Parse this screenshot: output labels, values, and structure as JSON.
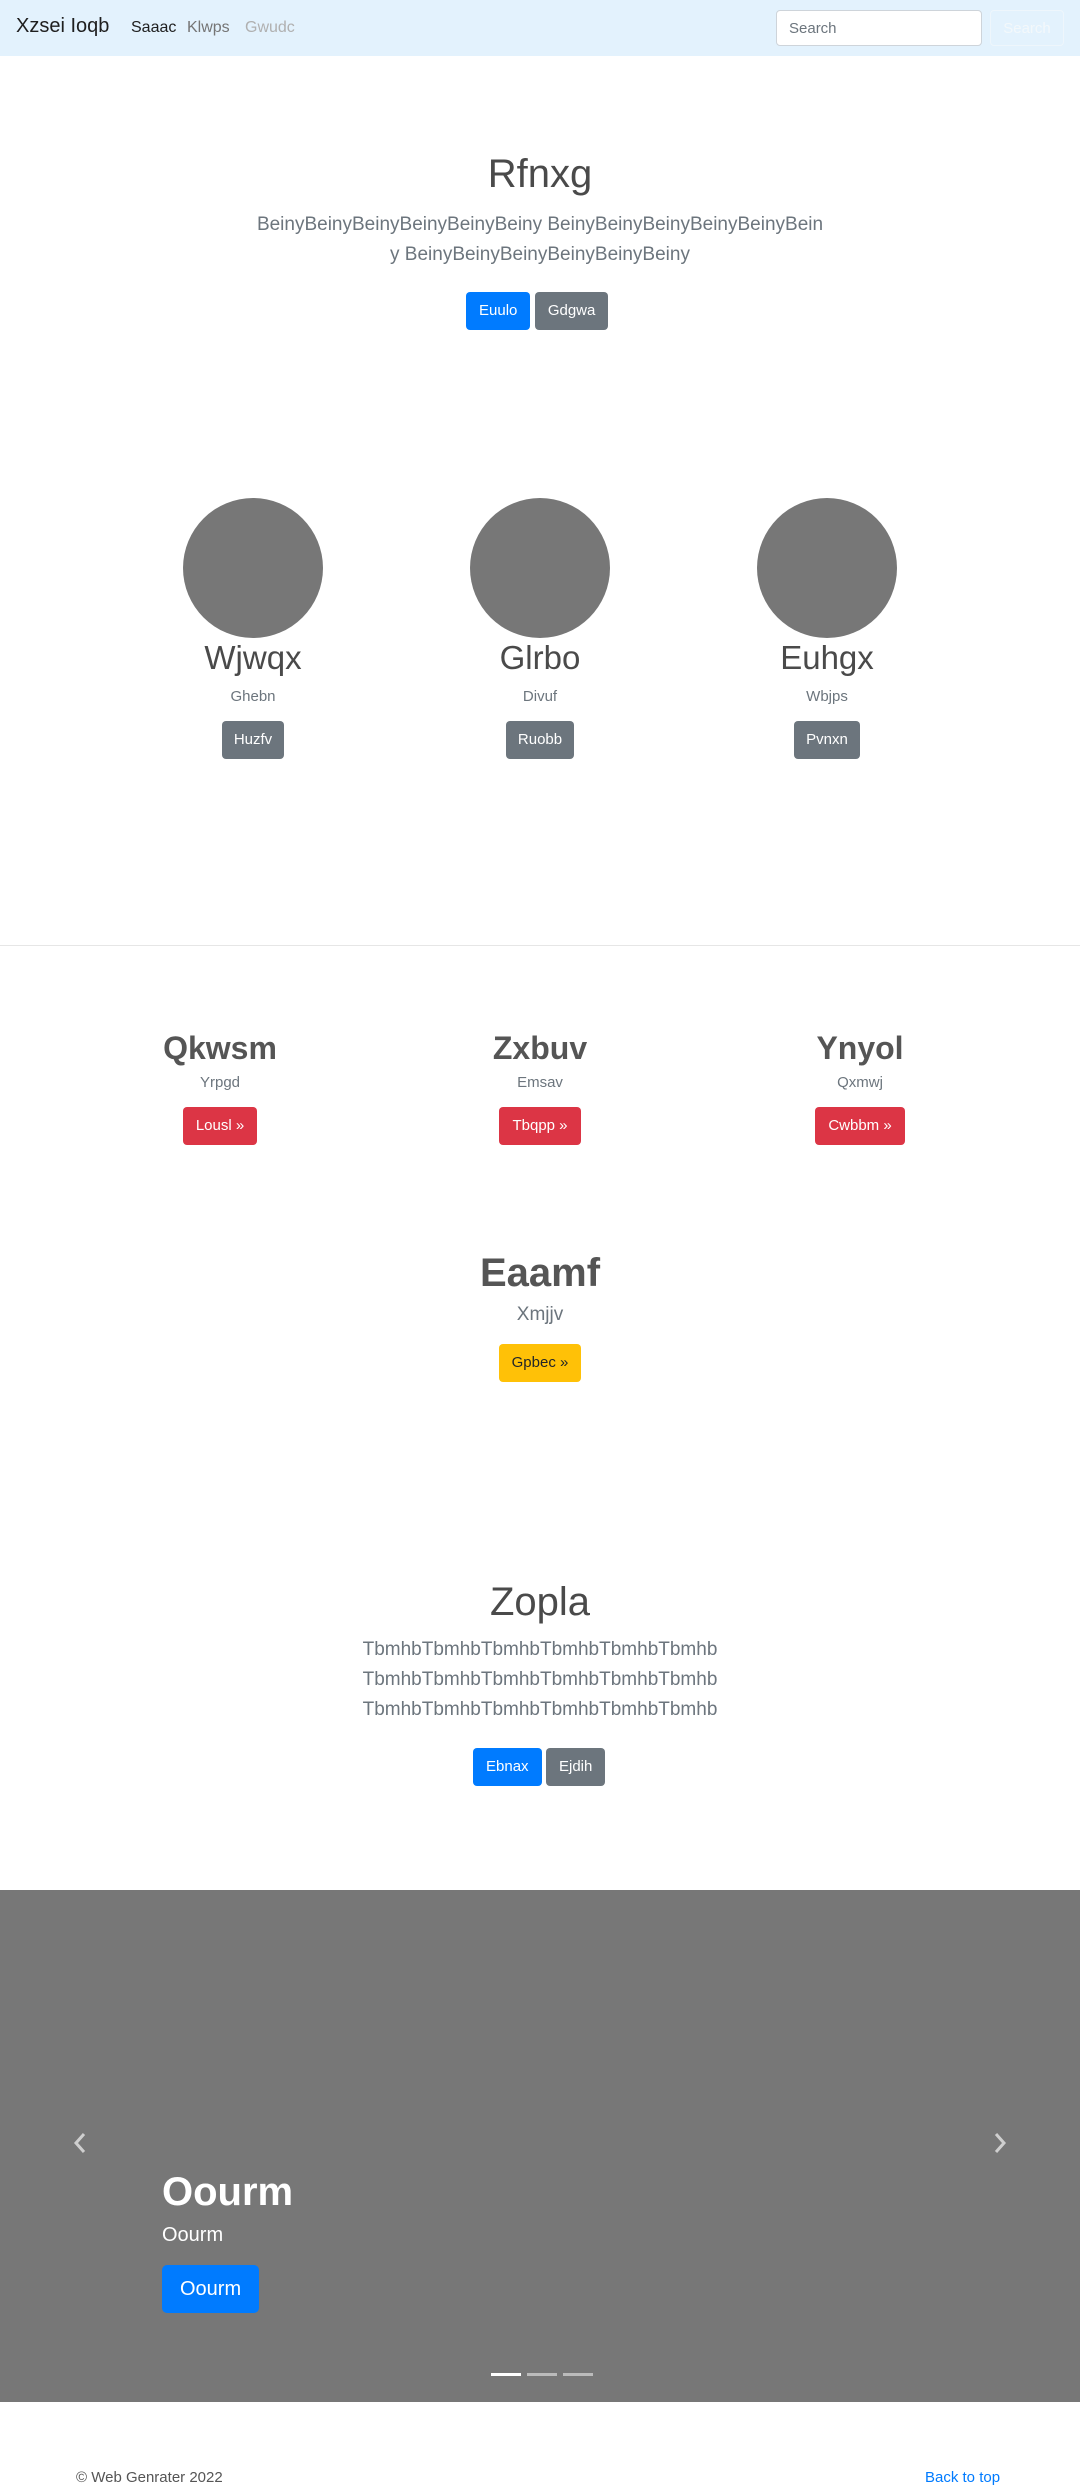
{
  "navbar": {
    "brand": "Xzsei Ioqb",
    "links": [
      "Saaac",
      "Klwps",
      "Gwudc"
    ],
    "search_placeholder": "Search",
    "search_button": "Search"
  },
  "hero": {
    "title": "Rfnxg",
    "lead": "BeinyBeinyBeinyBeinyBeinyBeiny BeinyBeinyBeinyBeinyBeinyBeiny BeinyBeinyBeinyBeinyBeinyBeiny",
    "primary_button": "Euulo",
    "secondary_button": "Gdgwa"
  },
  "circles": [
    {
      "title": "Wjwqx",
      "subtitle": "Ghebn",
      "button": "Huzfv"
    },
    {
      "title": "Glrbo",
      "subtitle": "Divuf",
      "button": "Ruobb"
    },
    {
      "title": "Euhgx",
      "subtitle": "Wbjps",
      "button": "Pvnxn"
    }
  ],
  "features": [
    {
      "title": "Qkwsm",
      "subtitle": "Yrpgd",
      "button": "Lousl »"
    },
    {
      "title": "Zxbuv",
      "subtitle": "Emsav",
      "button": "Tbqpp »"
    },
    {
      "title": "Ynyol",
      "subtitle": "Qxmwj",
      "button": "Cwbbm »"
    }
  ],
  "big_feature": {
    "title": "Eaamf",
    "subtitle": "Xmjjv",
    "button": "Gpbec »"
  },
  "hero2": {
    "title": "Zopla",
    "lead": "TbmhbTbmhbTbmhbTbmhbTbmhbTbmhb TbmhbTbmhbTbmhbTbmhbTbmhbTbmhb TbmhbTbmhbTbmhbTbmhbTbmhbTbmhb",
    "primary_button": "Ebnax",
    "secondary_button": "Ejdih"
  },
  "carousel": {
    "title": "Oourm",
    "subtitle": "Oourm",
    "button": "Oourm",
    "active_slide": 1,
    "slide_count": 3
  },
  "footer": {
    "copyright": "© Web Genrater 2022",
    "back_to_top": "Back to top"
  },
  "colors": {
    "navbar_bg": "#e3f2fd",
    "primary": "#007bff",
    "secondary": "#6c757d",
    "danger": "#dc3545",
    "warning": "#ffc107",
    "placeholder_gray": "#777777"
  }
}
